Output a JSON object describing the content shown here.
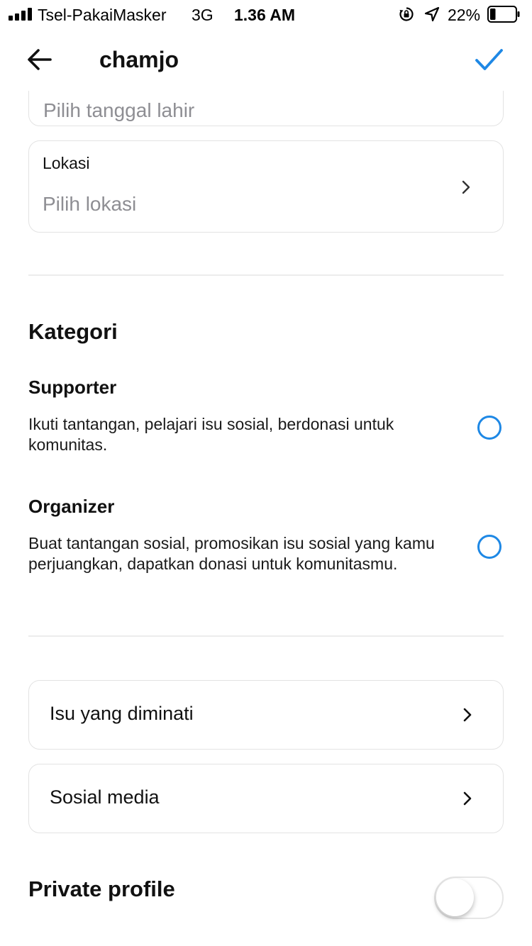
{
  "status_bar": {
    "carrier": "Tsel-PakaiMasker",
    "network": "3G",
    "time": "1.36 AM",
    "battery": "22%",
    "battery_level": 0.22
  },
  "header": {
    "title": "chamjo",
    "back_icon": "arrow-left-icon",
    "confirm_icon": "checkmark-icon",
    "accent_color": "#1e88e5"
  },
  "form": {
    "birth_date_placeholder": "Pilih tanggal lahir",
    "location_label": "Lokasi",
    "location_placeholder": "Pilih lokasi"
  },
  "category": {
    "title": "Kategori",
    "options": [
      {
        "title": "Supporter",
        "description": "Ikuti tantangan, pelajari isu sosial, berdonasi untuk komunitas.",
        "selected": false
      },
      {
        "title": "Organizer",
        "description": "Buat tantangan sosial, promosikan isu sosial yang kamu perjuangkan, dapatkan donasi untuk komunitasmu.",
        "selected": false
      }
    ]
  },
  "links": [
    {
      "label": "Isu yang diminati",
      "icon": "chevron-right-icon"
    },
    {
      "label": "Sosial media",
      "icon": "chevron-right-icon"
    }
  ],
  "privacy": {
    "label": "Private profile",
    "enabled": false
  }
}
